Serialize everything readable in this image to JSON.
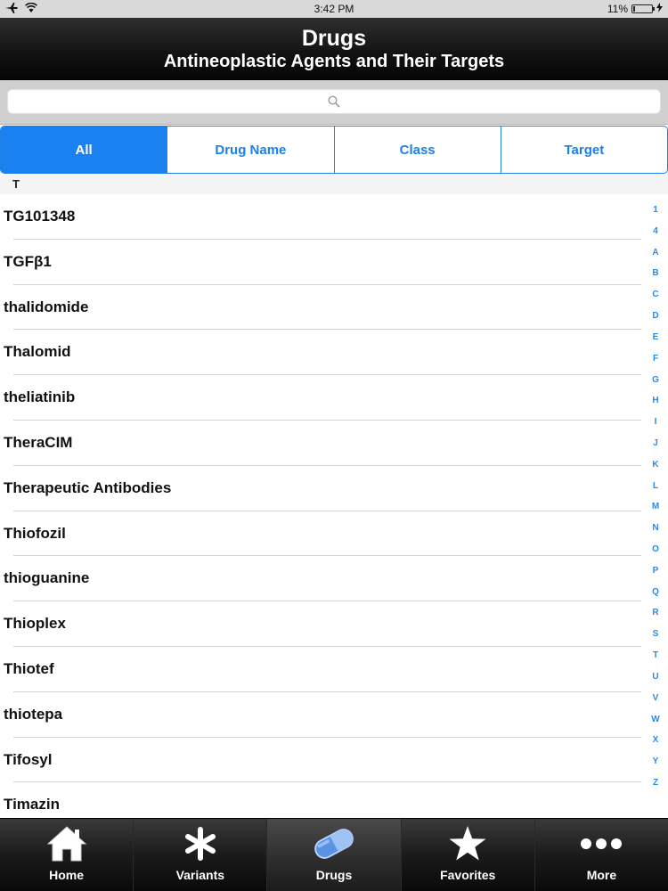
{
  "status_bar": {
    "time": "3:42 PM",
    "battery": "11%",
    "battery_level": 0.11
  },
  "header": {
    "title": "Drugs",
    "subtitle": "Antineoplastic Agents and Their Targets"
  },
  "search": {
    "placeholder": ""
  },
  "segments": [
    {
      "label": "All",
      "active": true
    },
    {
      "label": "Drug Name",
      "active": false
    },
    {
      "label": "Class",
      "active": false
    },
    {
      "label": "Target",
      "active": false
    }
  ],
  "section": {
    "header": "T"
  },
  "list": {
    "items": [
      "TG101348",
      "TGFβ1",
      "thalidomide",
      "Thalomid",
      "theliatinib",
      "TheraCIM",
      "Therapeutic Antibodies",
      "Thiofozil",
      "thioguanine",
      "Thioplex",
      "Thiotef",
      "thiotepa",
      "Tifosyl",
      "Timazin"
    ]
  },
  "index": [
    "1",
    "4",
    "A",
    "B",
    "C",
    "D",
    "E",
    "F",
    "G",
    "H",
    "I",
    "J",
    "K",
    "L",
    "M",
    "N",
    "O",
    "P",
    "Q",
    "R",
    "S",
    "T",
    "U",
    "V",
    "W",
    "X",
    "Y",
    "Z"
  ],
  "tab_bar": {
    "tabs": [
      {
        "label": "Home",
        "icon": "home-icon",
        "active": false
      },
      {
        "label": "Variants",
        "icon": "asterisk-icon",
        "active": false
      },
      {
        "label": "Drugs",
        "icon": "pill-icon",
        "active": true
      },
      {
        "label": "Favorites",
        "icon": "star-icon",
        "active": false
      },
      {
        "label": "More",
        "icon": "ellipsis-icon",
        "active": false
      }
    ]
  },
  "colors": {
    "accent": "#1a82f0",
    "index_letters": "#2a8be8"
  }
}
